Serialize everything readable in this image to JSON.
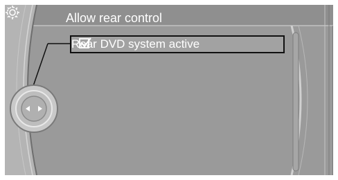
{
  "header": {
    "title": "Allow rear control",
    "icon": "gear-icon"
  },
  "menu": {
    "items": [
      {
        "label": "Rear DVD system active",
        "checked": true,
        "icon": "checkbox-checked-icon"
      }
    ]
  },
  "controller": {
    "icon": "controller-knob-icon",
    "left_arrow": "arrow-left-icon",
    "right_arrow": "arrow-right-icon"
  },
  "colors": {
    "screen_bg": "#9a9a9a",
    "header_bar": "#8e8e8e",
    "text": "#ffffff",
    "highlight_border": "#101010"
  }
}
